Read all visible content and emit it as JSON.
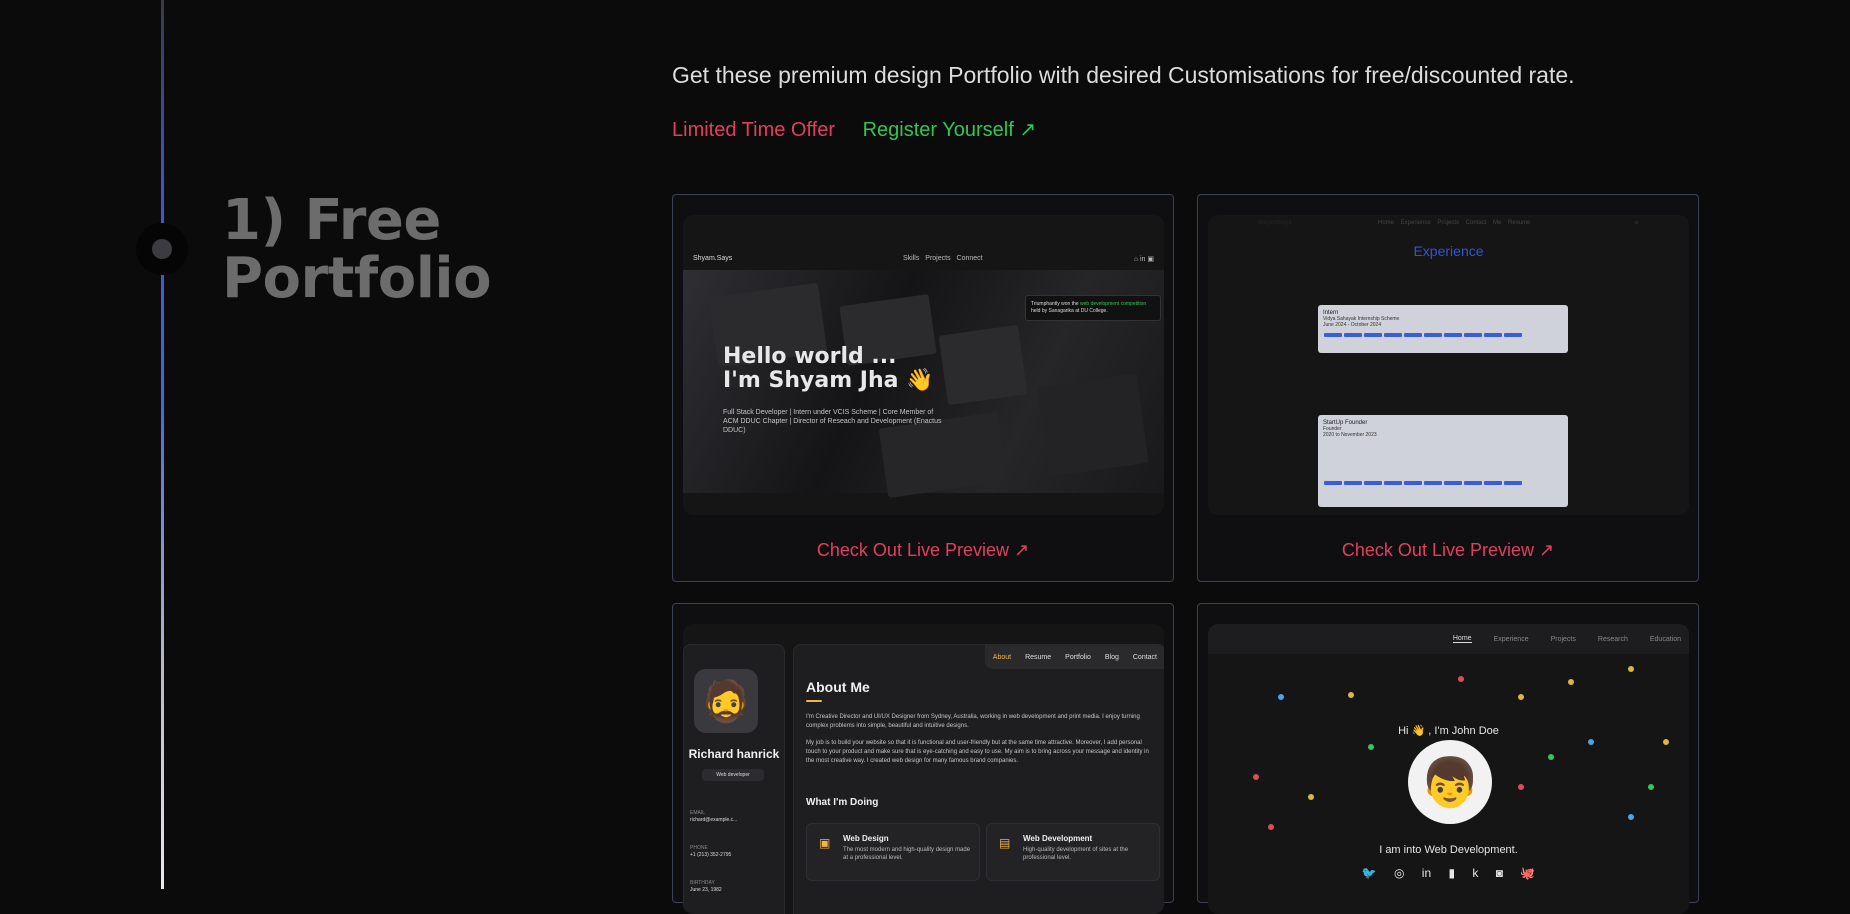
{
  "step": {
    "title": "1) Free Portfolio"
  },
  "intro": "Get these premium design Portfolio with desired Customisations for free/discounted rate.",
  "offer": {
    "limited": "Limited Time Offer",
    "register": "Register Yourself ↗"
  },
  "colors": {
    "accent_red": "#e0405f",
    "accent_green": "#33c457",
    "timeline_blue": "#3f68e0"
  },
  "cards": [
    {
      "preview_label": "Check Out Live Preview ↗",
      "screenshot": {
        "brand": "Shyam.Says",
        "nav": "Skills Projects Connect",
        "icons": "⌂ in ▣",
        "hello_line1": "Hello world ...",
        "hello_line2": "I'm Shyam Jha 👋",
        "subtitle": "Full Stack Developer | Intern under VCIS Scheme | Core Member of ACM DDUC Chapter | Director of Reseach and Development (Enactus DDUC)",
        "toast_prefix": "Triumphantly won the",
        "toast_highlight": "web development competition",
        "toast_suffix": "held by Sanagarika at DU College."
      }
    },
    {
      "preview_label": "Check Out Live Preview ↗",
      "screenshot": {
        "brand": "ShyamSays",
        "nav": "Home Experience Projects Contact Me Resume",
        "toggle": "☼",
        "title": "Experience",
        "entry1_title": "Intern",
        "entry1_org": "Vidya Sahayak Internship Scheme",
        "entry1_date": "June 2024 - October 2024",
        "entry2_title": "StartUp Founder",
        "entry2_org": "Founder",
        "entry2_date": "2020 to November 2023"
      }
    },
    {
      "screenshot": {
        "name": "Richard hanrick",
        "role": "Web developer",
        "email_label": "EMAIL",
        "email": "richard@example.c...",
        "phone_label": "PHONE",
        "phone": "+1 (213) 352-2795",
        "birthday_label": "BIRTHDAY",
        "birthday": "June 23, 1982",
        "tabs": [
          "About",
          "Resume",
          "Portfolio",
          "Blog",
          "Contact"
        ],
        "about_title": "About Me",
        "para1": "I'm Creative Director and UI/UX Designer from Sydney, Australia, working in web development and print media. I enjoy turning complex problems into simple, beautiful and intuitive designs.",
        "para2": "My job is to build your website so that it is functional and user-friendly but at the same time attractive. Moreover, I add personal touch to your product and make sure that is eye-catching and easy to use. My aim is to bring across your message and identity in the most creative way. I created web design for many famous brand companies.",
        "doing_title": "What I'm Doing",
        "services": [
          {
            "title": "Web Design",
            "desc": "The most modern and high-quality design made at a professional level."
          },
          {
            "title": "Web Development",
            "desc": "High-quality development of sites at the professional level."
          }
        ]
      }
    },
    {
      "screenshot": {
        "nav": [
          "Home",
          "Experience",
          "Projects",
          "Research",
          "Education"
        ],
        "greeting": "Hi 👋 , I'm John Doe",
        "into": "I am into Web Development.",
        "socials": "🐦 ◎ in ▮ k ◙ 🐙"
      }
    }
  ]
}
